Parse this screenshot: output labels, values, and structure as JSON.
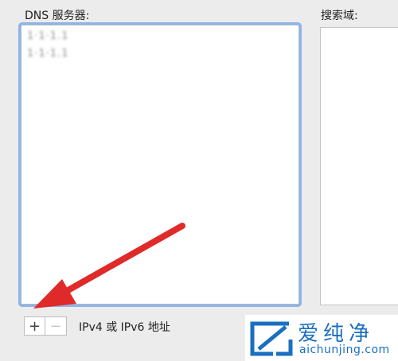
{
  "dns": {
    "label": "DNS 服务器:",
    "entries": [
      "1·1·1.1         ",
      "1·1·1.1          "
    ]
  },
  "search_domains": {
    "label": "搜索域:"
  },
  "buttons": {
    "add": "+",
    "remove": "−"
  },
  "hint": "IPv4 或 IPv6 地址",
  "watermark": {
    "brand": "爱纯净",
    "url": "aichunjing.com"
  },
  "colors": {
    "focus_ring": "#8fb4ea",
    "arrow": "#e02a2a",
    "watermark": "#1a6fc0"
  },
  "icons": {
    "arrow": "red-annotation-arrow-icon",
    "logo": "aichunjing-logo-icon"
  }
}
